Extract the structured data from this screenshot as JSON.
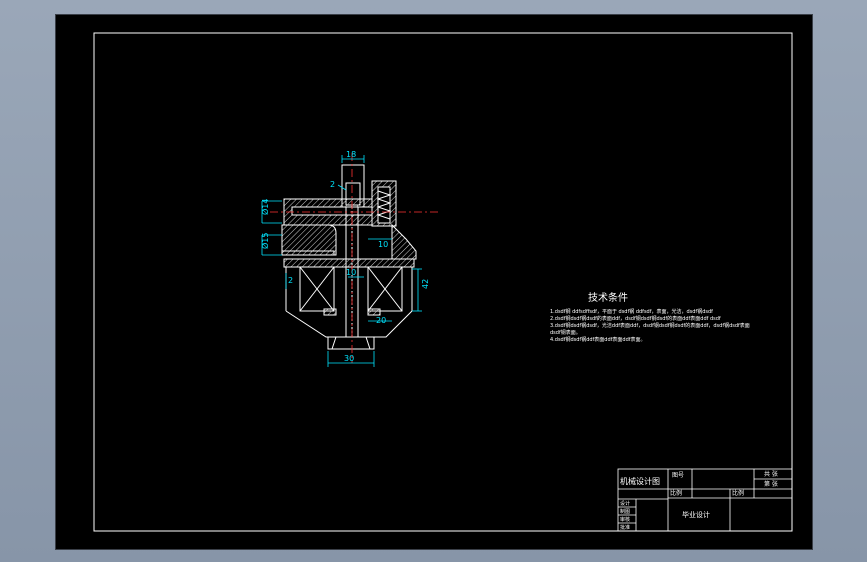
{
  "drawing": {
    "dimensions": {
      "top_width": "18",
      "small_arrow": "2",
      "left_diameter_upper": "Ø14",
      "left_diameter_lower": "Ø15",
      "left_small": "2",
      "center_rod": "10",
      "right_small": "10",
      "right_height": "42",
      "right_width": "20",
      "bottom_width": "30"
    },
    "notes": {
      "title": "技术条件",
      "lines": [
        "1.dsdf钢 ddfsdffsdf，平面于 dsdf钢 ddfsdf，表面，光洁，dsdf钢dsdf",
        "2.dsdf钢dsdf钢dsdf的表面ddf，dsdf钢dsdf钢dsdf的表面ddf表面ddf dsdf",
        "3.dsdf钢dsdf钢dsdf，光洁ddf表面ddf，dsdf钢dsdf钢dsdf的表面ddf，dsdf钢dsdf表面",
        "dsdf钢表面。",
        "4.dsdf钢dsdf钢ddf表面ddf表面ddf表面。"
      ]
    },
    "title_block": {
      "name": "机械设计图",
      "drawing_no": "图号",
      "ratio_label": "比例",
      "scale_label": "比例",
      "sheet_total": "共 张",
      "sheet_no": "第 张",
      "designer": "设计",
      "drafter": "制图",
      "reviewer": "审核",
      "approver": "批准",
      "project": "毕业设计"
    }
  },
  "colors": {
    "background": "#000000",
    "lines": "#ffffff",
    "dimensions": "#00e5ff",
    "hatch": "#d0d0d0",
    "center_lines": "#ff3333"
  }
}
